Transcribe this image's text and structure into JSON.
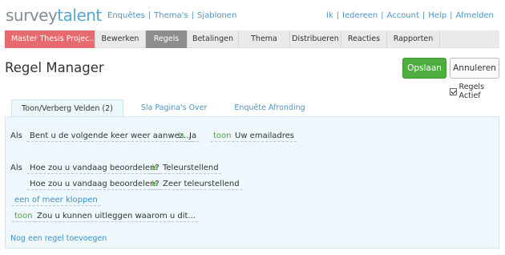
{
  "brand": {
    "part1": "survey",
    "part2": "talent"
  },
  "topnav_left": [
    "Enquêtes",
    "Thema's",
    "Sjablonen"
  ],
  "topnav_right": [
    "Ik",
    "Iedereen",
    "Account",
    "Help",
    "Afmelden"
  ],
  "mainnav": {
    "project": "Master Thesis Projec...",
    "items": [
      "Bewerken",
      "Regels",
      "Betalingen",
      "Thema",
      "Distribueren",
      "Reacties",
      "Rapporten"
    ],
    "active": "Regels"
  },
  "page": {
    "title": "Regel Manager",
    "save_label": "Opslaan",
    "cancel_label": "Annuleren",
    "active_label": "Regels Actief"
  },
  "tabs": [
    "Toon/Verberg Velden (2)",
    "Sla Pagina's Over",
    "Enquête Afronding"
  ],
  "rules": [
    {
      "if_label": "Als",
      "question": "Bent u de volgende keer weer aanwez...",
      "op": "is",
      "answer": "Ja",
      "action": "toon",
      "target": "Uw emailadres"
    },
    {
      "if_label": "Als",
      "conditions": [
        {
          "question": "Hoe zou u vandaag beoordelen?",
          "op": "is",
          "answer": "Teleurstellend"
        },
        {
          "question": "Hoe zou u vandaag beoordelen?",
          "op": "is",
          "answer": "Zeer teleurstellend"
        }
      ],
      "combinator": "een of meer kloppen",
      "action": "toon",
      "target": "Zou u kunnen uitleggen waarom u dit..."
    }
  ],
  "add_rule_label": "Nog een regel toevoegen",
  "colors": {
    "brand_gray": "#7f8d95",
    "brand_blue": "#55a6d1",
    "project_red": "#e76a6e",
    "active_tab": "#8d8d8d",
    "save_green": "#4dae3f",
    "panel_bg": "#eef8fc",
    "link_blue": "#4a95c7",
    "operator_green": "#4ba43c"
  }
}
